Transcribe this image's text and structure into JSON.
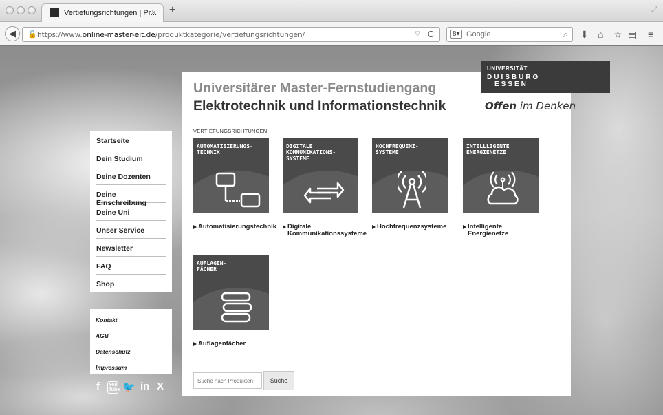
{
  "browser": {
    "tab_title": "Vertiefungsrichtungen | Pr...",
    "tab_close": "×",
    "new_tab": "+",
    "url_prefix": "https://www.",
    "url_domain": "online-master-eit.de",
    "url_path": "/produktkategorie/vertiefungsrichtungen/",
    "search_engine_badge": "8▾",
    "search_placeholder": "Google",
    "icons": [
      "back-icon",
      "lock-icon",
      "reload-icon",
      "search-icon",
      "download-icon",
      "home-icon",
      "star-icon",
      "reader-icon",
      "menu-icon"
    ]
  },
  "logo": {
    "line1": "UNIVERSITÄT",
    "line2": "DUISBURG",
    "line3": "ESSEN"
  },
  "header": {
    "title1": "Universitärer Master-Fernstudiengang",
    "title2": "Elektrotechnik und Informationstechnik",
    "motto_bold": "Offen",
    "motto_rest": " im Denken"
  },
  "sidebar": {
    "items": [
      {
        "label": "Startseite"
      },
      {
        "label": "Dein Studium"
      },
      {
        "label": "Deine Dozenten"
      },
      {
        "label": "Deine Einschreibung"
      },
      {
        "label": "Deine Uni"
      },
      {
        "label": "Unser Service"
      },
      {
        "label": "Newsletter"
      },
      {
        "label": "FAQ"
      },
      {
        "label": "Shop"
      }
    ],
    "secondary": [
      {
        "label": "Kontakt"
      },
      {
        "label": "AGB"
      },
      {
        "label": "Datenschutz"
      },
      {
        "label": "Impressum"
      }
    ],
    "social": [
      "f",
      "You\nTube",
      "🐦",
      "in",
      "X"
    ]
  },
  "content": {
    "section_label": "VERTIEFUNGSRICHTUNGEN",
    "tiles": [
      {
        "tile_label": "AUTOMATISIERUNGS-\nTECHNIK",
        "caption": "Automatisierungstechnik",
        "icon": "computer-network-icon"
      },
      {
        "tile_label": "DIGITALE\nKOMMUNIKATIONS-\nSYSTEME",
        "caption": "Digitale\nKommunikationssysteme",
        "icon": "exchange-arrows-icon"
      },
      {
        "tile_label": "HOCHFREQUENZ-\nSYSTEME",
        "caption": "Hochfrequenzsysteme",
        "icon": "antenna-icon"
      },
      {
        "tile_label": "INTELLLIGENTE\nENERGIENETZE",
        "caption": "Intelligente\nEnergienetze",
        "icon": "cloud-signal-icon"
      },
      {
        "tile_label": "AUFLAGEN-\nFÄCHER",
        "caption": "Auflagenfächer",
        "icon": "books-icon"
      }
    ],
    "search_placeholder": "Suche nach Produkten",
    "search_button": "Suche"
  }
}
